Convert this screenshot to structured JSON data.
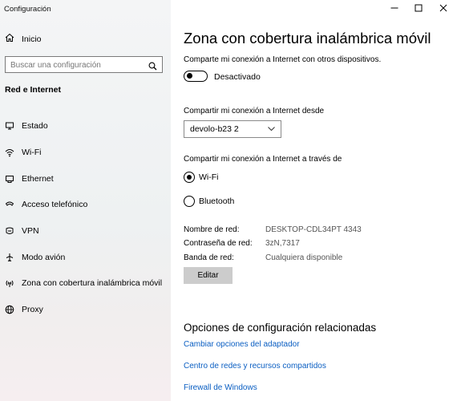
{
  "window": {
    "app_title": "Configuración",
    "controls": [
      "minimize",
      "maximize",
      "close"
    ]
  },
  "sidebar": {
    "home_label": "Inicio",
    "search_placeholder": "Buscar una configuración",
    "section_title": "Red e Internet",
    "items": [
      {
        "label": "Estado",
        "icon": "status-globe-icon"
      },
      {
        "label": "Wi-Fi",
        "icon": "wifi-icon"
      },
      {
        "label": "Ethernet",
        "icon": "ethernet-icon"
      },
      {
        "label": "Acceso telefónico",
        "icon": "dialup-icon"
      },
      {
        "label": "VPN",
        "icon": "vpn-icon"
      },
      {
        "label": "Modo avión",
        "icon": "airplane-icon"
      },
      {
        "label": "Zona con cobertura inalámbrica móvil",
        "icon": "hotspot-icon"
      },
      {
        "label": "Proxy",
        "icon": "proxy-globe-icon"
      }
    ]
  },
  "main": {
    "title": "Zona con cobertura inalámbrica móvil",
    "share_desc": "Comparte mi conexión a Internet con otros dispositivos.",
    "toggle_state": "Desactivado",
    "share_from_label": "Compartir mi conexión a Internet desde",
    "share_from_value": "devolo-b23 2",
    "share_via_label": "Compartir mi conexión a Internet a través de",
    "radio_options": [
      {
        "label": "Wi-Fi",
        "selected": true
      },
      {
        "label": "Bluetooth",
        "selected": false
      }
    ],
    "network_name_label": "Nombre de red:",
    "network_name_value": "DESKTOP-CDL34PT 4343",
    "password_label": "Contraseña de red:",
    "password_value": "3zN,7317",
    "band_label": "Banda de red:",
    "band_value": "Cualquiera disponible",
    "edit_button": "Editar",
    "related_title": "Opciones de configuración relacionadas",
    "related_links": [
      "Cambiar opciones del adaptador",
      "Centro de redes y recursos compartidos",
      "Firewall de Windows"
    ]
  },
  "colors": {
    "link": "#0a5ec2",
    "sidebar_bg": "#f2f3f4",
    "button_bg": "#cccccc"
  }
}
